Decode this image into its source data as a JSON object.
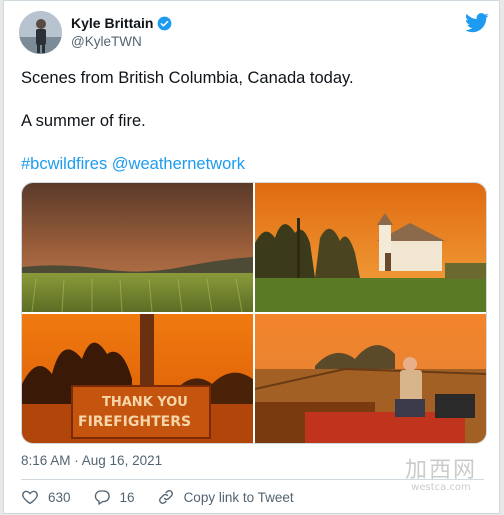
{
  "author": {
    "name": "Kyle Brittain",
    "handle": "@KyleTWN",
    "verified": true
  },
  "tweet": {
    "line1": "Scenes from British Columbia, Canada today.",
    "line2": "A summer of fire.",
    "hashtag1": "#bcwildfires",
    "mention1": "@weathernetwork",
    "timestamp": "8:16 AM · Aug 16, 2021"
  },
  "media": {
    "photo_sign_text_line1": "THANK YOU",
    "photo_sign_text_line2": "FIREFIGHTERS"
  },
  "actions": {
    "likes": "630",
    "replies": "16",
    "copy_link_label": "Copy link to Tweet"
  },
  "watermark": {
    "cn": "加西网",
    "en": "westca.com"
  },
  "colors": {
    "link_blue": "#1d9bf0",
    "muted_gray": "#536471",
    "smoke_orange": "#e8851e"
  },
  "icons": {
    "brand": "twitter-bird-icon",
    "verified": "verified-badge-icon",
    "like": "heart-icon",
    "reply": "reply-bubble-icon",
    "copy": "link-icon"
  }
}
